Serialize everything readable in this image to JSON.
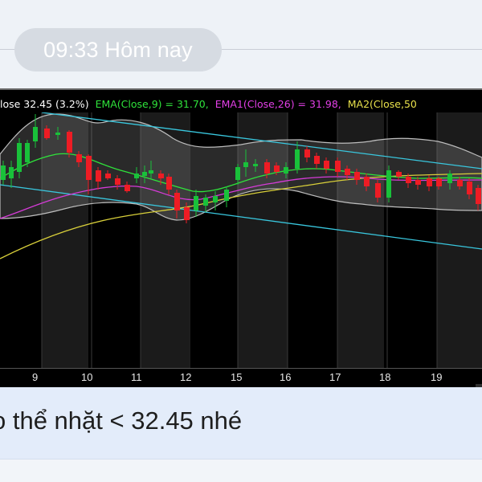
{
  "timestamp": {
    "label": "09:33 Hôm nay"
  },
  "chart": {
    "indicators": {
      "close": "lose 32.45 (3.2%)",
      "ema": "EMA(Close,9) = 31.70,",
      "ema1": "EMA1(Close,26) = 31.98,",
      "ma2": "MA2(Close,50"
    },
    "date_labels": [
      "9",
      "10",
      "11",
      "12",
      "15",
      "16",
      "17",
      "18",
      "19"
    ],
    "colors": {
      "up_candle": "#19c13a",
      "down_candle": "#ee1c24",
      "ema_line": "#2fe33b",
      "ema1_line": "#d63bd8",
      "ma2_line": "#d8cf3a",
      "trend_line": "#39c7de",
      "band": "#c0c0c0"
    }
  },
  "message": {
    "text": "o thể nhặt < 32.45 nhé"
  }
}
